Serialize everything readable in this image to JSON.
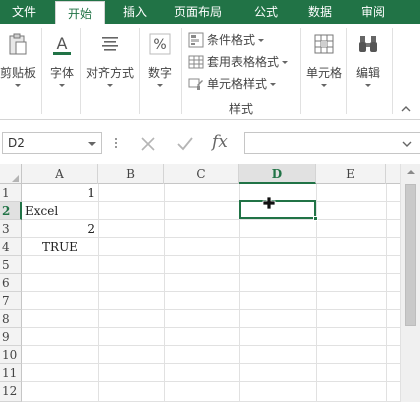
{
  "ribbon_tabs": [
    "文件",
    "开始",
    "插入",
    "页面布局",
    "公式",
    "数据",
    "审阅"
  ],
  "active_tab": "开始",
  "ribbon": {
    "clipboard_label": "剪贴板",
    "font_label": "字体",
    "alignment_label": "对齐方式",
    "number_label": "数字",
    "styles": {
      "conditional_formatting": "条件格式",
      "format_as_table": "套用表格格式",
      "cell_styles": "单元格样式",
      "group_label": "样式"
    },
    "cells_label": "单元格",
    "editing_label": "编辑"
  },
  "formula_bar": {
    "name_box": "D2",
    "formula": "",
    "fx_label": "fx"
  },
  "grid": {
    "columns": [
      "A",
      "B",
      "C",
      "D",
      "E"
    ],
    "selected_column": "D",
    "rows": [
      "1",
      "2",
      "3",
      "4",
      "5",
      "6",
      "7",
      "8",
      "9",
      "10",
      "11",
      "12"
    ],
    "selected_row": "2",
    "cells": [
      {
        "ref": "A1",
        "value": "1",
        "type": "num"
      },
      {
        "ref": "A2",
        "value": "Excel",
        "type": "txt"
      },
      {
        "ref": "A3",
        "value": "2",
        "type": "num"
      },
      {
        "ref": "A4",
        "value": "TRUE",
        "type": "bool"
      }
    ],
    "active_cell": "D2"
  },
  "colors": {
    "accent": "#217346",
    "grid_line": "#e1e1e1",
    "header_bg": "#f3f3f3"
  }
}
